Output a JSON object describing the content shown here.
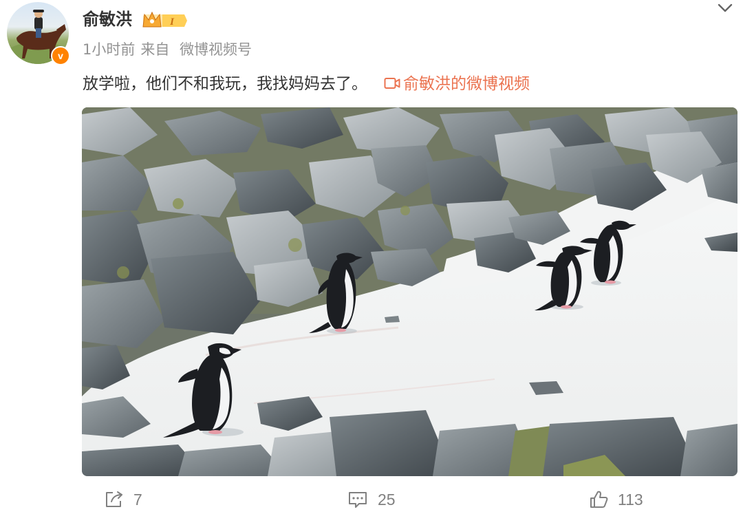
{
  "author": {
    "name": "俞敏洪",
    "avatar_icon": "avatar-horse-rider",
    "verified_icon": "verified-v-icon",
    "verified_mark": "v",
    "vip_level": "I",
    "vip_icon": "crown-icon"
  },
  "meta": {
    "time": "1小时前",
    "source_prefix": "来自",
    "source": "微博视频号"
  },
  "post": {
    "text": "放学啦，他们不和我玩，我找妈妈去了。",
    "video_link_label": "俞敏洪的微博视频",
    "video_link_icon": "video-icon"
  },
  "media": {
    "type": "video-thumbnail",
    "subject_icon": "penguin-snow-scene"
  },
  "actions": {
    "share_count": "7",
    "comment_count": "25",
    "like_count": "113"
  },
  "colors": {
    "link": "#eb7350",
    "meta_gray": "#939393",
    "action_gray": "#808080",
    "badge_orange": "#ff8200"
  }
}
